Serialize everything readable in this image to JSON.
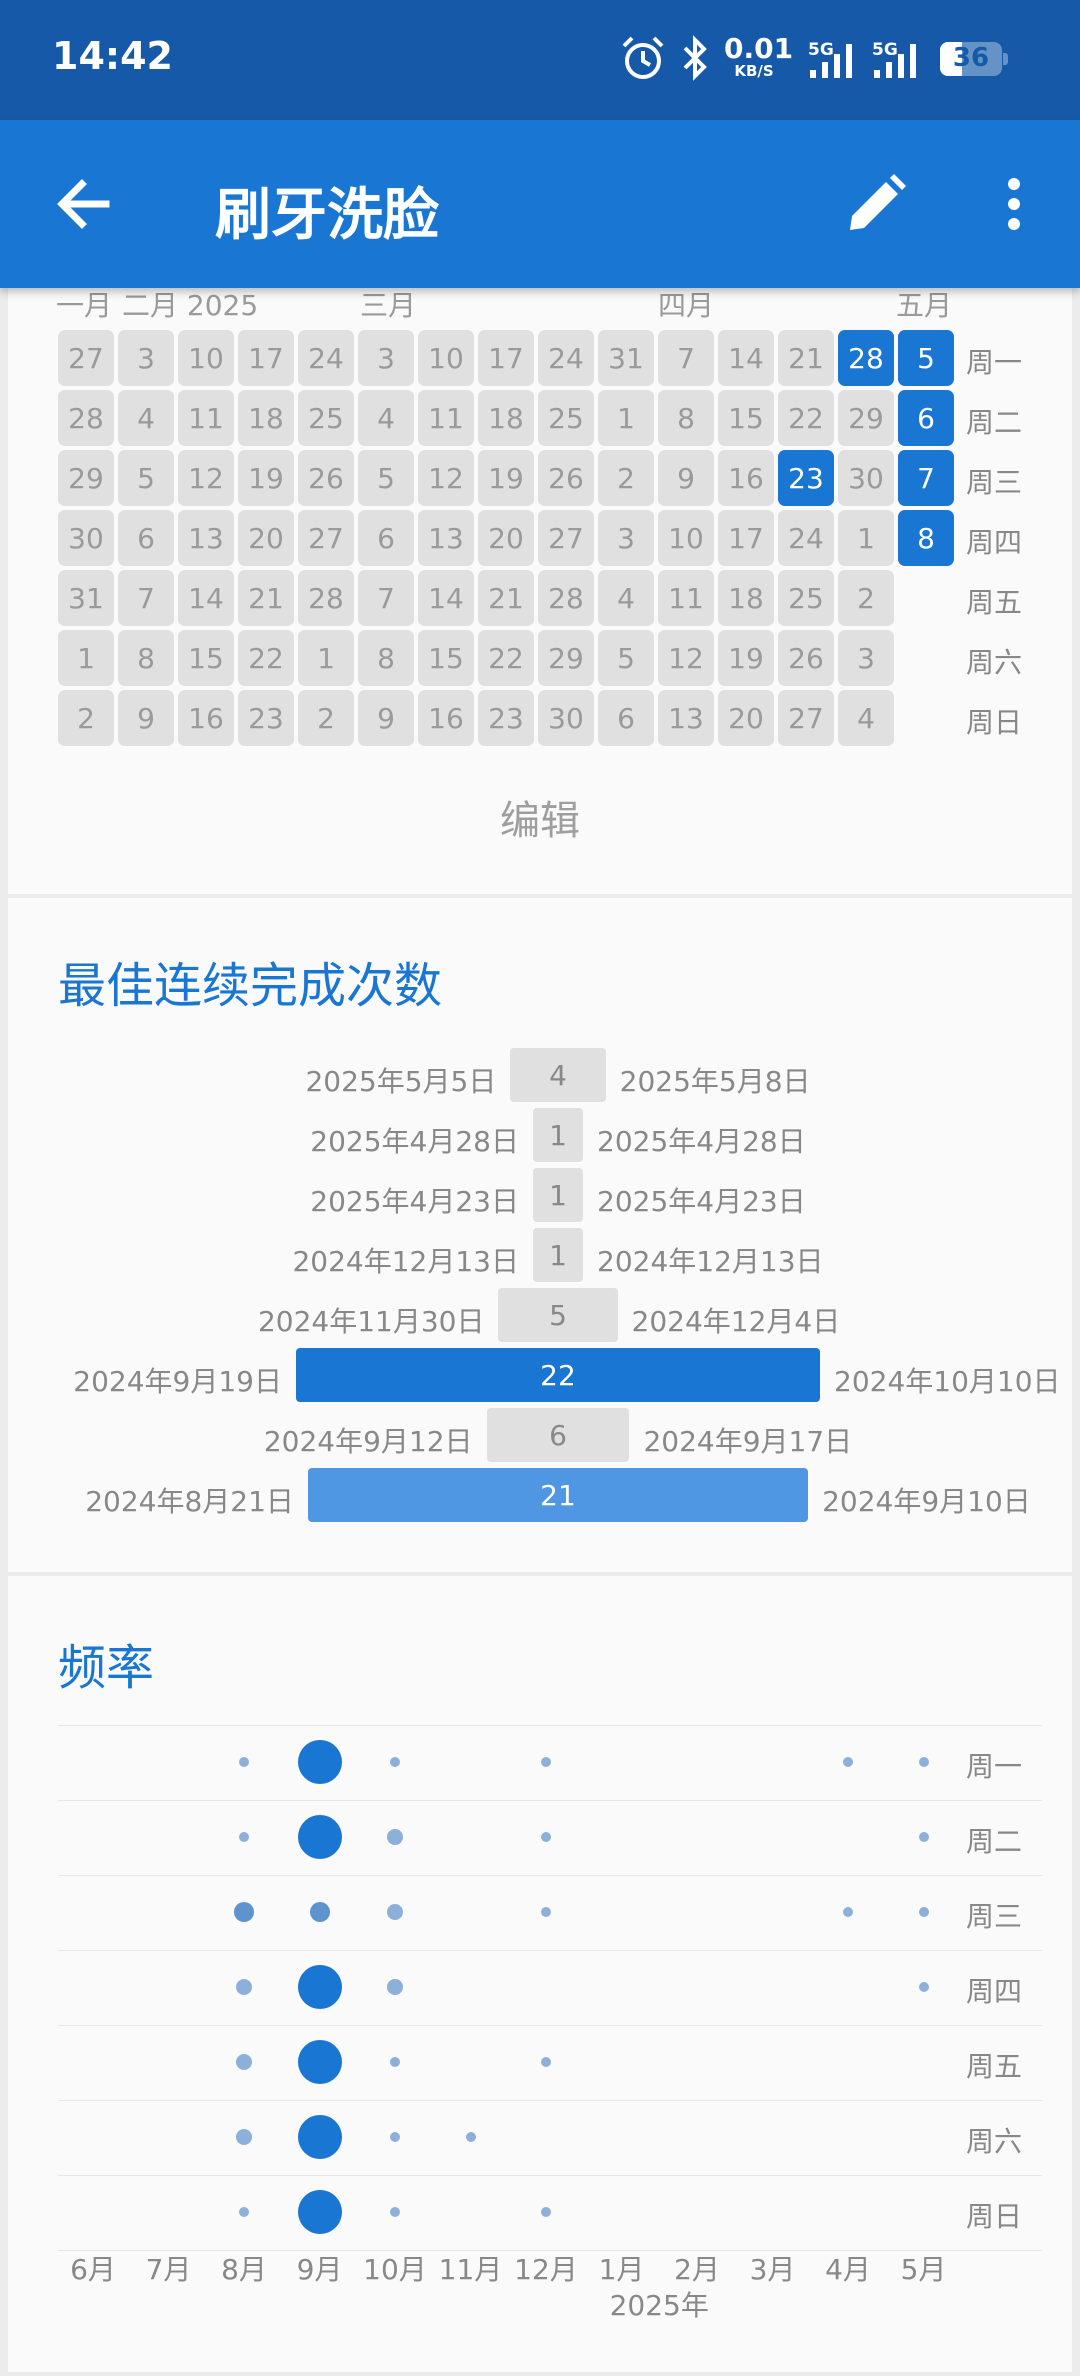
{
  "status_bar": {
    "time": "14:42",
    "net_speed": "0.01",
    "net_unit": "KB/S",
    "signal1": "5G",
    "signal2": "5G",
    "battery": "36"
  },
  "app_bar": {
    "title": "刷牙洗脸",
    "back_icon": "back-arrow-icon",
    "edit_icon": "pencil-icon",
    "more_icon": "more-vert-icon"
  },
  "colors": {
    "accent": "#1976d2",
    "status_bar": "#1559a8",
    "light_blue": "#4f97e2",
    "dot": "#8db0da"
  },
  "calendar": {
    "month_labels": [
      "一月",
      "二月 2025",
      "三月",
      "四月",
      "五月"
    ],
    "day_labels": [
      "周一",
      "周二",
      "周三",
      "周四",
      "周五",
      "周六",
      "周日"
    ],
    "columns": [
      [
        "27",
        "28",
        "29",
        "30",
        "31",
        "1",
        "2"
      ],
      [
        "3",
        "4",
        "5",
        "6",
        "7",
        "8",
        "9"
      ],
      [
        "10",
        "11",
        "12",
        "13",
        "14",
        "15",
        "16"
      ],
      [
        "17",
        "18",
        "19",
        "20",
        "21",
        "22",
        "23"
      ],
      [
        "24",
        "25",
        "26",
        "27",
        "28",
        "1",
        "2"
      ],
      [
        "3",
        "4",
        "5",
        "6",
        "7",
        "8",
        "9"
      ],
      [
        "10",
        "11",
        "12",
        "13",
        "14",
        "15",
        "16"
      ],
      [
        "17",
        "18",
        "19",
        "20",
        "21",
        "22",
        "23"
      ],
      [
        "24",
        "25",
        "26",
        "27",
        "28",
        "29",
        "30"
      ],
      [
        "31",
        "1",
        "2",
        "3",
        "4",
        "5",
        "6"
      ],
      [
        "7",
        "8",
        "9",
        "10",
        "11",
        "12",
        "13"
      ],
      [
        "14",
        "15",
        "16",
        "17",
        "18",
        "19",
        "20"
      ],
      [
        "21",
        "22",
        "23",
        "24",
        "25",
        "26",
        "27"
      ],
      [
        "28",
        "29",
        "30",
        "1",
        "2",
        "3",
        "4"
      ],
      [
        "5",
        "6",
        "7",
        "8",
        "",
        "",
        ""
      ]
    ],
    "completed_dates": [
      "2025-04-23",
      "2025-04-28",
      "2025-05-05",
      "2025-05-06",
      "2025-05-07",
      "2025-05-08"
    ],
    "edit_label": "编辑"
  },
  "streaks": {
    "title": "最佳连续完成次数",
    "items": [
      {
        "start": "2025年5月5日",
        "end": "2025年5月8日",
        "count": "4"
      },
      {
        "start": "2025年4月28日",
        "end": "2025年4月28日",
        "count": "1"
      },
      {
        "start": "2025年4月23日",
        "end": "2025年4月23日",
        "count": "1"
      },
      {
        "start": "2024年12月13日",
        "end": "2024年12月13日",
        "count": "1"
      },
      {
        "start": "2024年11月30日",
        "end": "2024年12月4日",
        "count": "5"
      },
      {
        "start": "2024年9月19日",
        "end": "2024年10月10日",
        "count": "22"
      },
      {
        "start": "2024年9月12日",
        "end": "2024年9月17日",
        "count": "6"
      },
      {
        "start": "2024年8月21日",
        "end": "2024年9月10日",
        "count": "21"
      }
    ]
  },
  "frequency": {
    "title": "频率",
    "months": [
      "6月",
      "7月",
      "8月",
      "9月",
      "10月",
      "11月",
      "12月",
      "1月",
      "2月",
      "3月",
      "4月",
      "5月"
    ],
    "year_label": "2025年",
    "weekdays": [
      "周一",
      "周二",
      "周三",
      "周四",
      "周五",
      "周六",
      "周日"
    ],
    "grid": [
      [
        0,
        0,
        1,
        5,
        1,
        0,
        1,
        0,
        0,
        0,
        1,
        1
      ],
      [
        0,
        0,
        1,
        5,
        2,
        0,
        1,
        0,
        0,
        0,
        0,
        1
      ],
      [
        0,
        0,
        3,
        3,
        2,
        0,
        1,
        0,
        0,
        0,
        1,
        1
      ],
      [
        0,
        0,
        2,
        5,
        2,
        0,
        0,
        0,
        0,
        0,
        0,
        1
      ],
      [
        0,
        0,
        2,
        5,
        1,
        0,
        1,
        0,
        0,
        0,
        0,
        0
      ],
      [
        0,
        0,
        2,
        5,
        1,
        1,
        0,
        0,
        0,
        0,
        0,
        0
      ],
      [
        0,
        0,
        1,
        5,
        1,
        0,
        1,
        0,
        0,
        0,
        0,
        0
      ]
    ]
  }
}
